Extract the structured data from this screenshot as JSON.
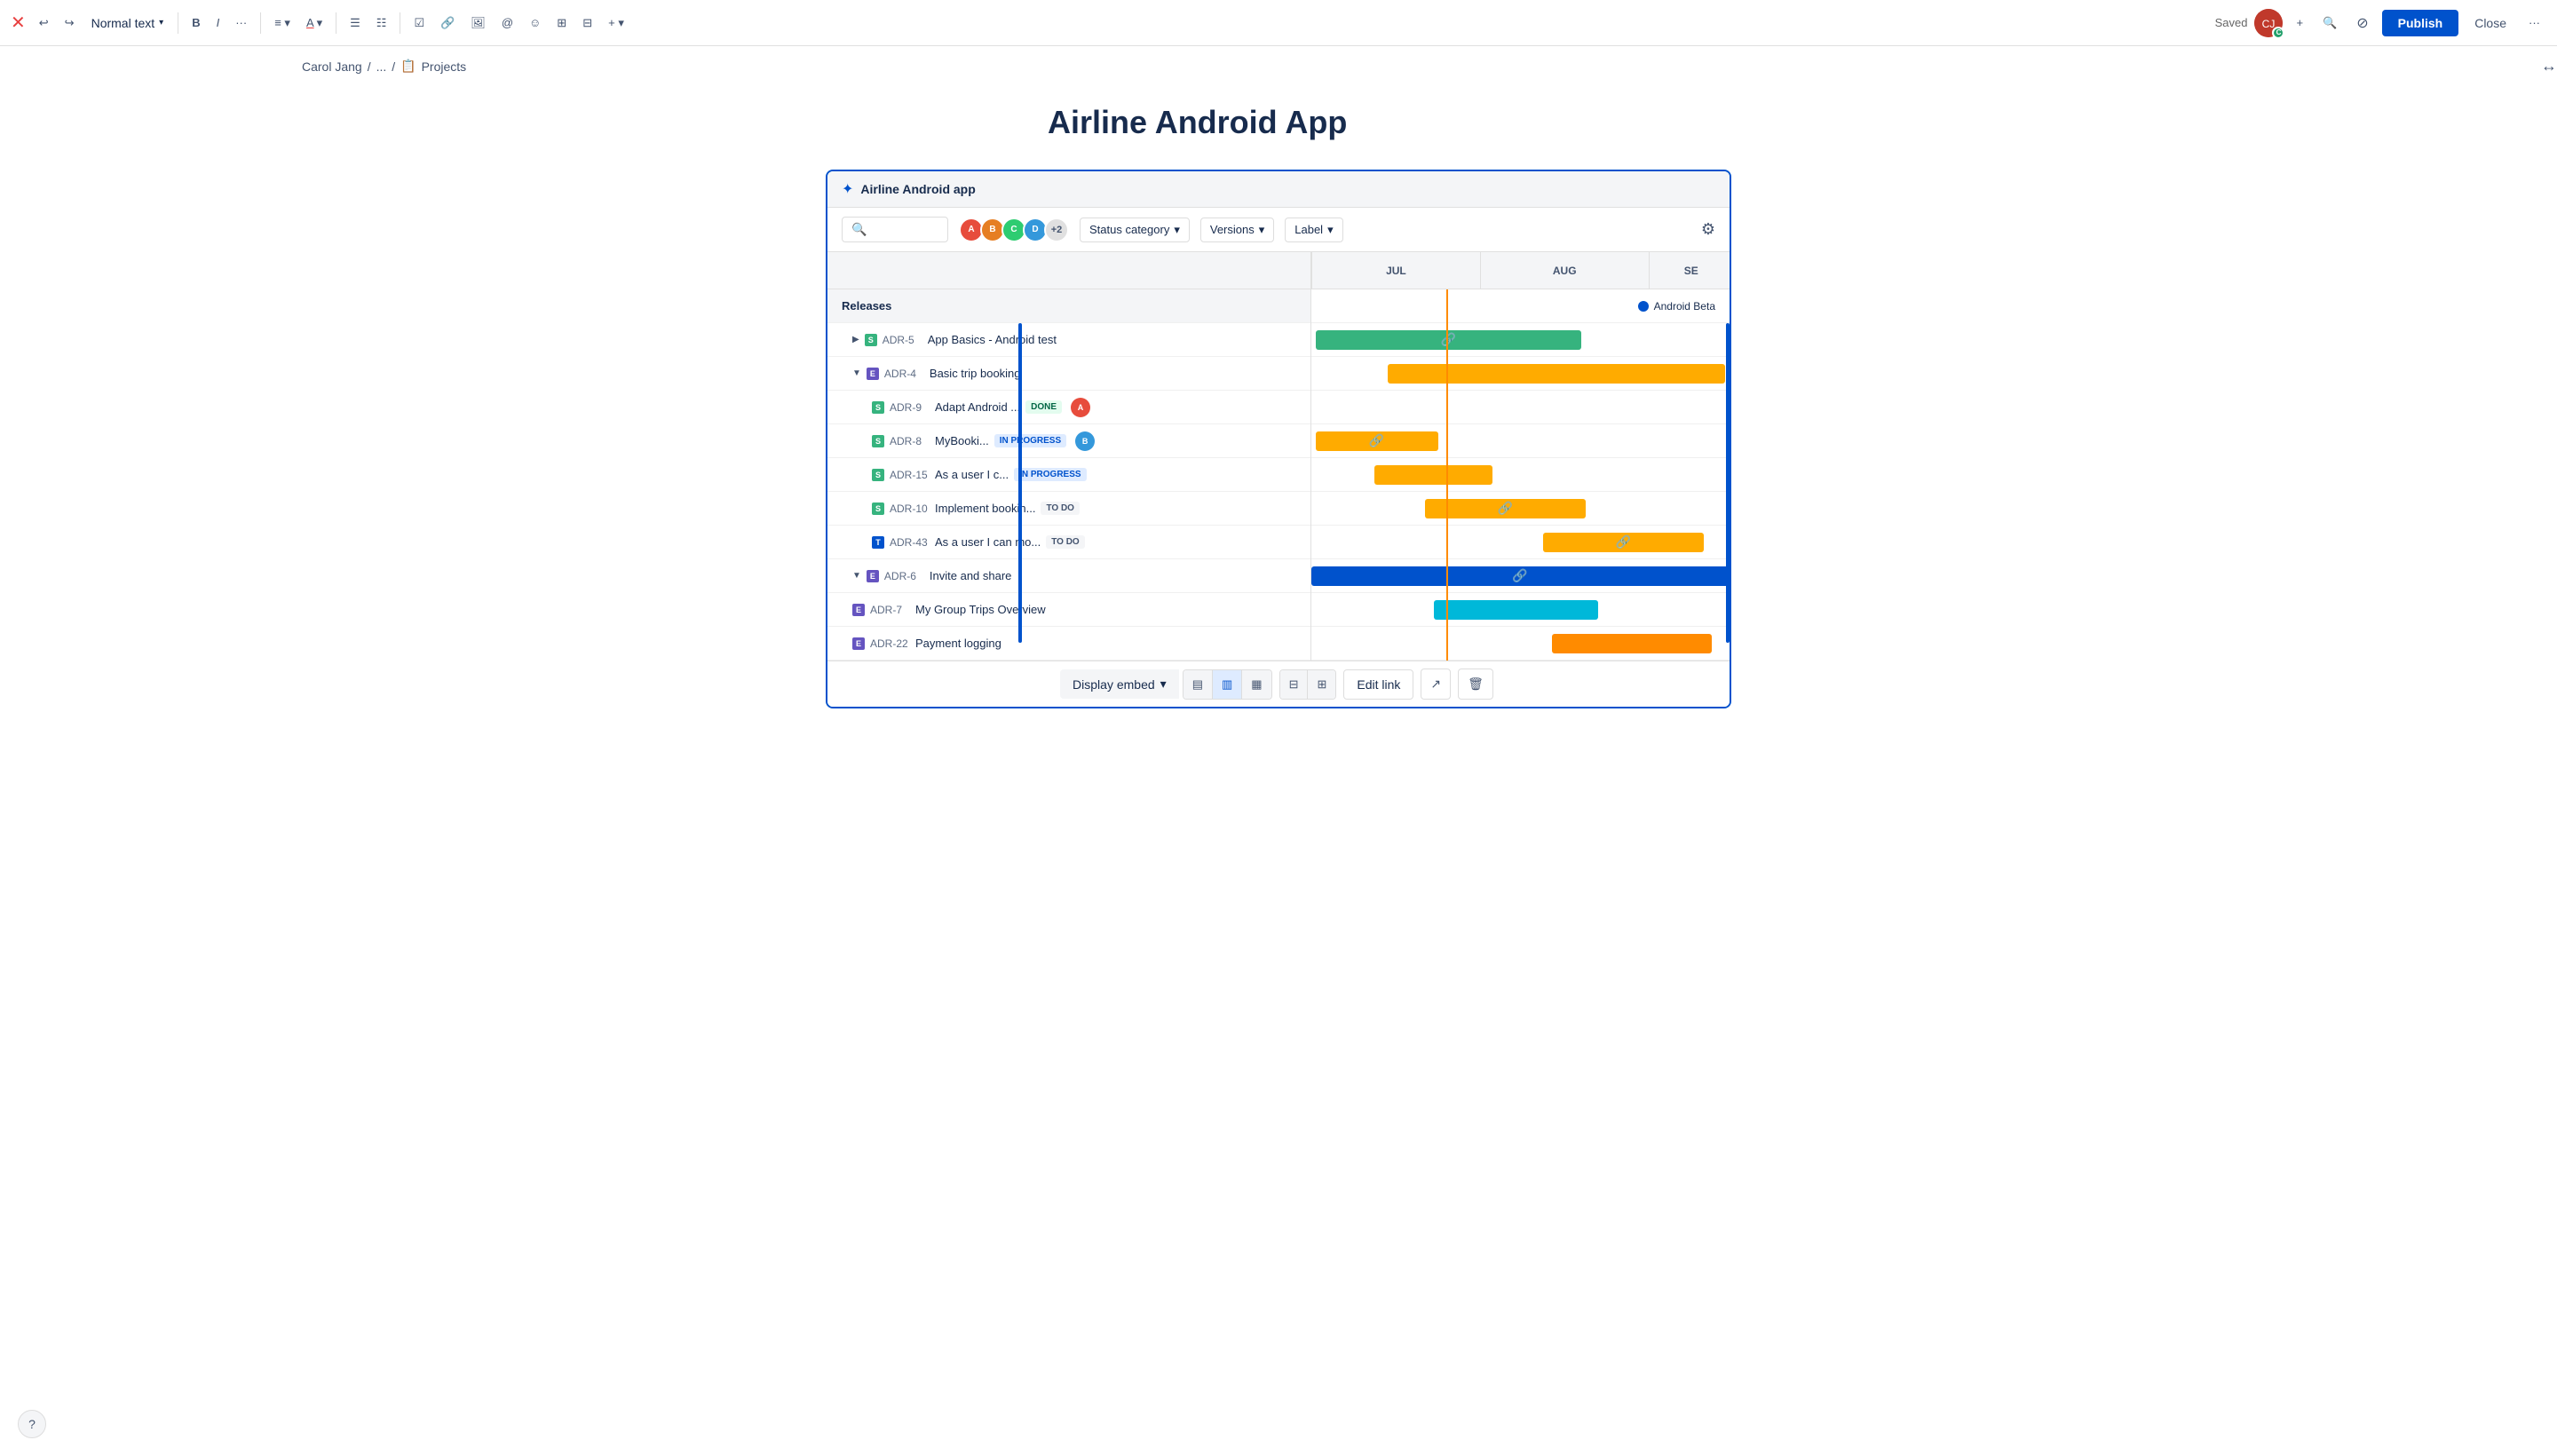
{
  "toolbar": {
    "logo_icon": "✕",
    "undo_icon": "↩",
    "redo_icon": "↪",
    "text_format_label": "Normal text",
    "bold_label": "B",
    "italic_label": "I",
    "more_label": "...",
    "align_label": "≡",
    "color_label": "A",
    "bullet_label": "•",
    "number_label": "#",
    "check_label": "☑",
    "link_label": "🔗",
    "image_label": "🖼",
    "at_label": "@",
    "emoji_label": "😊",
    "table_label": "⊞",
    "layout_label": "⊟",
    "plus_label": "+",
    "saved_label": "Saved",
    "avatar_initials": "CJ",
    "add_icon": "+",
    "search_icon": "🔍",
    "restrict_icon": "🚫",
    "publish_label": "Publish",
    "close_label": "Close",
    "more_options_label": "..."
  },
  "breadcrumb": {
    "author": "Carol Jang",
    "sep1": "/",
    "ellipsis": "...",
    "sep2": "/",
    "section_icon": "📋",
    "section_label": "Projects"
  },
  "page": {
    "title": "Airline Android App"
  },
  "embed": {
    "header_icon": "✦",
    "header_title": "Airline Android app",
    "search_placeholder": "",
    "avatars_extra": "+2",
    "filter1_label": "Status category",
    "filter2_label": "Versions",
    "filter3_label": "Label",
    "months": [
      "JUL",
      "AUG",
      "SE"
    ],
    "releases_label": "Releases",
    "release_tag": "Android Beta",
    "tasks": [
      {
        "id": "ADR-5",
        "name": "App Basics - Android test",
        "icon": "story",
        "indent": 1,
        "expandable": true,
        "status": null,
        "avatar": null,
        "bar": {
          "color": "green",
          "left": "0%",
          "width": "63%"
        },
        "has_link": true
      },
      {
        "id": "ADR-4",
        "name": "Basic trip booking",
        "icon": "epic",
        "indent": 1,
        "expandable": true,
        "status": null,
        "avatar": null,
        "bar": {
          "color": "yellow",
          "left": "18%",
          "width": "82%"
        },
        "has_link": false
      },
      {
        "id": "ADR-9",
        "name": "Adapt Android ...",
        "icon": "story",
        "indent": 2,
        "expandable": false,
        "status": "DONE",
        "avatar": "person1",
        "bar": null,
        "has_link": false
      },
      {
        "id": "ADR-8",
        "name": "MyBooki...",
        "icon": "story",
        "indent": 2,
        "expandable": false,
        "status": "IN PROGRESS",
        "avatar": "person2",
        "bar": {
          "color": "yellow",
          "left": "0%",
          "width": "30%"
        },
        "has_link": true
      },
      {
        "id": "ADR-15",
        "name": "As a user I c...",
        "icon": "story",
        "indent": 2,
        "expandable": false,
        "status": "IN PROGRESS",
        "avatar": null,
        "bar": {
          "color": "yellow",
          "left": "13%",
          "width": "30%"
        },
        "has_link": false
      },
      {
        "id": "ADR-10",
        "name": "Implement bookin...",
        "icon": "story",
        "indent": 2,
        "expandable": false,
        "status": "TO DO",
        "avatar": null,
        "bar": {
          "color": "yellow",
          "left": "27%",
          "width": "40%"
        },
        "has_link": true
      },
      {
        "id": "ADR-43",
        "name": "As a user I can mo...",
        "icon": "task",
        "indent": 2,
        "expandable": false,
        "status": "TO DO",
        "avatar": null,
        "bar": {
          "color": "yellow",
          "left": "55%",
          "width": "38%"
        },
        "has_link": true
      },
      {
        "id": "ADR-6",
        "name": "Invite and share",
        "icon": "epic",
        "indent": 1,
        "expandable": true,
        "status": null,
        "avatar": null,
        "bar": {
          "color": "blue",
          "left": "0%",
          "width": "100%"
        },
        "has_link": true
      },
      {
        "id": "ADR-7",
        "name": "My Group Trips Overview",
        "icon": "epic",
        "indent": 1,
        "expandable": false,
        "status": null,
        "avatar": null,
        "bar": {
          "color": "cyan",
          "left": "27%",
          "width": "40%"
        },
        "has_link": false
      },
      {
        "id": "ADR-22",
        "name": "Payment logging",
        "icon": "epic",
        "indent": 1,
        "expandable": false,
        "status": null,
        "avatar": null,
        "bar": {
          "color": "orange",
          "left": "57%",
          "width": "38%"
        },
        "has_link": false
      }
    ]
  },
  "bottom_toolbar": {
    "display_embed_label": "Display embed",
    "dropdown_icon": "▾",
    "align_left_icon": "▤",
    "align_center_icon": "▥",
    "align_right_icon": "▦",
    "align_wide_icon": "⊟",
    "align_full_icon": "⊞",
    "edit_link_label": "Edit link",
    "open_icon": "↗",
    "delete_icon": "🗑"
  },
  "help_icon": "?"
}
